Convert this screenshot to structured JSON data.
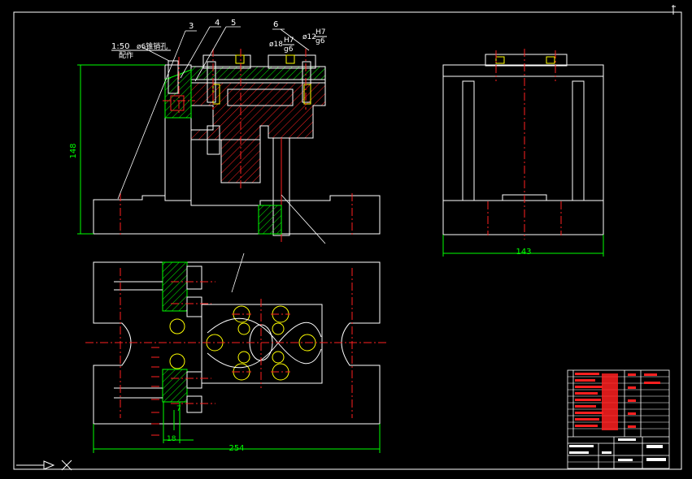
{
  "colors": {
    "background": "#000000",
    "outline": "#ffffff",
    "centerline": "#ff2020",
    "dimension": "#00ff00",
    "hatch": "#00ff00",
    "section_hatch": "#ff2020",
    "detail": "#ffff00"
  },
  "leaders": {
    "l3": "3",
    "l4": "4",
    "l5": "5",
    "l6": "6"
  },
  "notes": {
    "taper_pin_1": "1:50",
    "taper_pin_2": "ø6锥销孔",
    "taper_pin_3": "配作",
    "fit_left_dia": "ø18",
    "fit_left_hole": "H7",
    "fit_left_shaft": "g6",
    "fit_right_dia": "ø12",
    "fit_right_hole": "H7",
    "fit_right_shaft": "g6"
  },
  "dimensions": {
    "height_front": "148",
    "width_side": "143",
    "width_top": "254",
    "small_1": "7",
    "small_2": "18"
  },
  "icons": {
    "ucs": "ucs-arrow-icon",
    "cross": "cross-cursor-icon"
  }
}
